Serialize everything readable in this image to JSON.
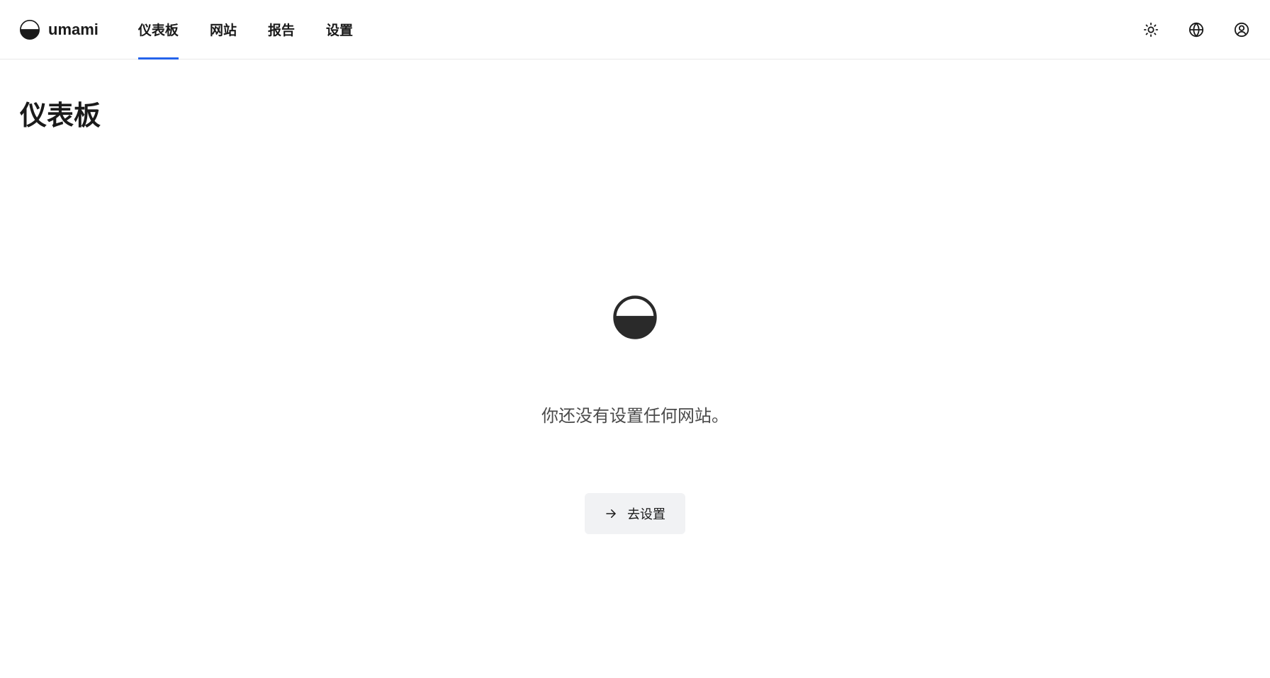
{
  "header": {
    "brand": "umami",
    "nav": {
      "dashboard": "仪表板",
      "websites": "网站",
      "reports": "报告",
      "settings": "设置"
    }
  },
  "page": {
    "title": "仪表板"
  },
  "empty_state": {
    "message": "你还没有设置任何网站。",
    "button_label": "去设置"
  }
}
